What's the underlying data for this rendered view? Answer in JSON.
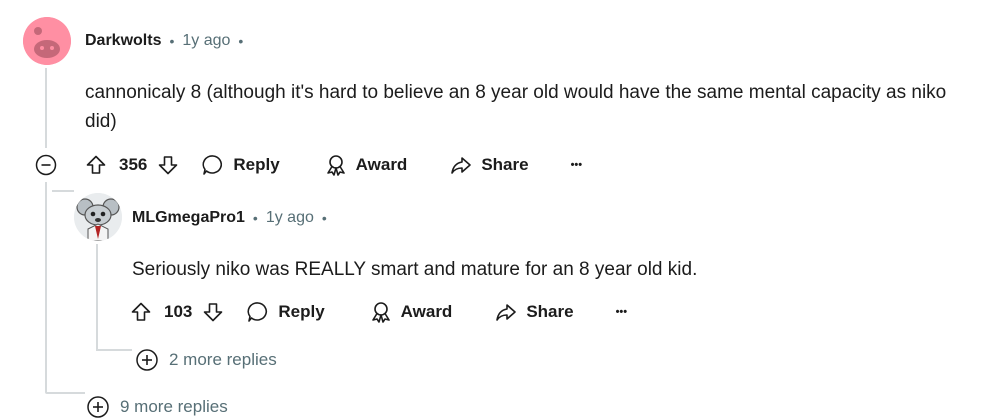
{
  "comment": {
    "author": "Darkwolts",
    "age": "1y ago",
    "text": "cannonicaly 8 (although it's hard to believe an 8 year old would have the same mental capacity as niko did)",
    "votes": "356",
    "reply_label": "Reply",
    "award_label": "Award",
    "share_label": "Share",
    "more_label": "•••"
  },
  "reply": {
    "author": "MLGmegaPro1",
    "age": "1y ago",
    "text": "Seriously niko was REALLY smart and mature for an 8 year old kid.",
    "votes": "103",
    "reply_label": "Reply",
    "award_label": "Award",
    "share_label": "Share",
    "more_label": "•••",
    "more_replies": "2 more replies"
  },
  "thread": {
    "more_replies": "9 more replies"
  },
  "colors": {
    "avatar_pink": "#ff8fa3",
    "line": "#d6dadc",
    "muted": "#576f76"
  }
}
